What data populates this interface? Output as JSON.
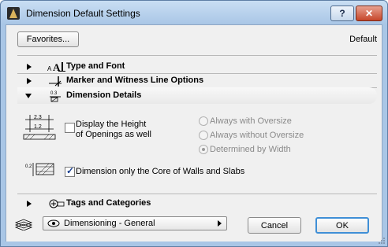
{
  "window": {
    "title": "Dimension Default Settings",
    "help_label": "?",
    "close_label": "✕"
  },
  "header": {
    "favorites_label": "Favorites...",
    "default_label": "Default"
  },
  "sections": {
    "type_font": {
      "label": "Type and Font"
    },
    "marker_witness": {
      "label": "Marker and Witness Line Options"
    },
    "dimension_details": {
      "label": "Dimension Details"
    },
    "tags_categories": {
      "label": "Tags and Categories"
    }
  },
  "details": {
    "display_height_label_line1": "Display the Height",
    "display_height_label_line2": "of Openings as well",
    "display_height_checked": false,
    "radio_options": [
      {
        "label": "Always with Oversize",
        "selected": false
      },
      {
        "label": "Always without Oversize",
        "selected": false
      },
      {
        "label": "Determined by Width",
        "selected": true
      }
    ],
    "core_only_label": "Dimension only the Core of Walls and Slabs",
    "core_only_checked": true,
    "dim_icon_top": "2.3",
    "dim_icon_bottom": "1.2"
  },
  "footer": {
    "layer_combo_label": "Dimensioning - General",
    "cancel_label": "Cancel",
    "ok_label": "OK"
  }
}
